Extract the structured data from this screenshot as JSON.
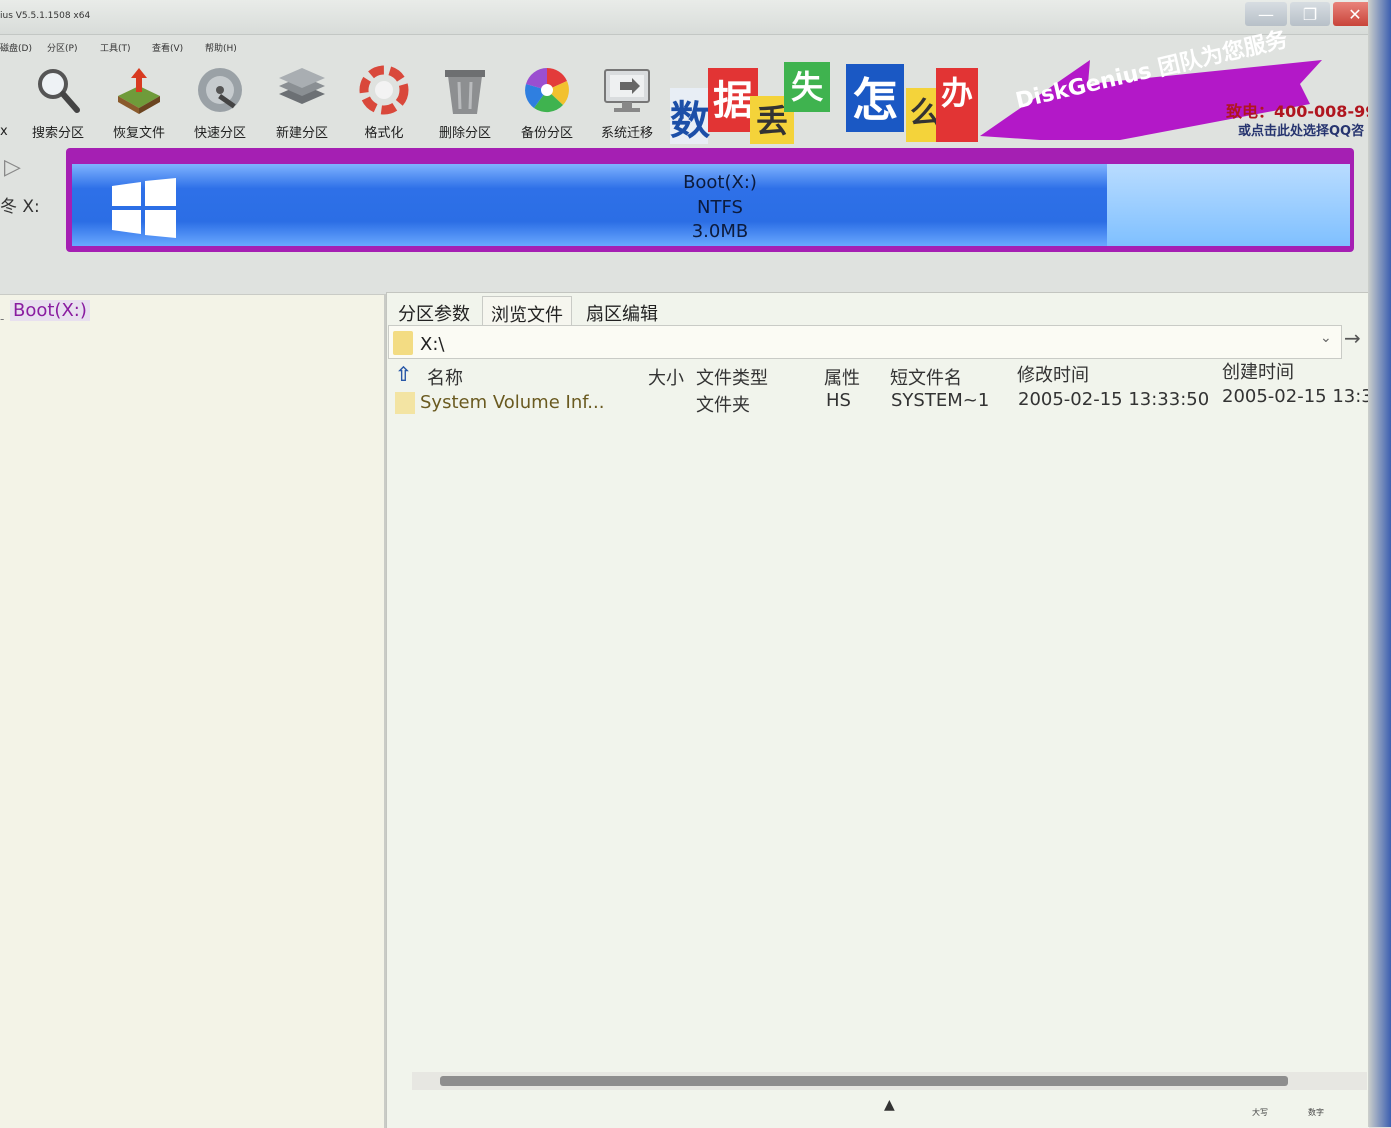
{
  "window": {
    "title": "ius V5.5.1.1508 x64",
    "min_glyph": "—",
    "max_glyph": "❐",
    "close_glyph": "✕"
  },
  "menu": [
    "磁盘(D)",
    "分区(P)",
    "工具(T)",
    "查看(V)",
    "帮助(H)"
  ],
  "toolbar": [
    {
      "label": "搜索分区",
      "icon": "search-icon"
    },
    {
      "label": "恢复文件",
      "icon": "restore-file-icon"
    },
    {
      "label": "快速分区",
      "icon": "disk-icon"
    },
    {
      "label": "新建分区",
      "icon": "new-partition-icon"
    },
    {
      "label": "格式化",
      "icon": "format-icon"
    },
    {
      "label": "删除分区",
      "icon": "trash-icon"
    },
    {
      "label": "备份分区",
      "icon": "backup-icon"
    },
    {
      "label": "系统迁移",
      "icon": "migrate-icon"
    }
  ],
  "toolbar_cut_label": "x",
  "banner": {
    "chars": [
      "数",
      "据",
      "丢",
      "失",
      "怎",
      "么",
      "办"
    ],
    "slogan": "DiskGenius 团队为您服务",
    "phone": "致电：400-008-99!",
    "qq": "或点击此处选择QQ咨"
  },
  "disk": {
    "name": "Boot(X:)",
    "fs": "NTFS",
    "size": "3.0MB",
    "side_label": "冬 X:",
    "side_arrow": "▷"
  },
  "tree": {
    "node": "Boot(X:)",
    "dash": "-"
  },
  "tabs": [
    "分区参数",
    "浏览文件",
    "扇区编辑"
  ],
  "path": {
    "value": "X:\\",
    "dropdown": "⌄",
    "go": "→"
  },
  "columns": [
    "名称",
    "大小",
    "文件类型",
    "属性",
    "短文件名",
    "修改时间",
    "创建时间"
  ],
  "rows": [
    {
      "name": "System Volume Inf...",
      "size": "",
      "type": "文件夹",
      "attr": "HS",
      "short": "SYSTEM~1",
      "modified": "2005-02-15 13:33:50",
      "created": "2005-02-15 13:3"
    }
  ],
  "status": {
    "caps": "大写",
    "num": "数字"
  },
  "colors": {
    "partition_border": "#a51fb3",
    "partition_fill": "#2b6ee5",
    "tree_label": "#8a1ca0"
  }
}
